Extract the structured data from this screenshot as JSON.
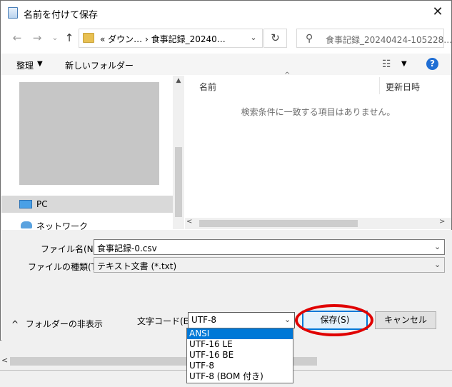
{
  "window": {
    "title": "名前を付けて保存",
    "close_glyph": "✕"
  },
  "nav": {
    "back": "←",
    "forward": "→",
    "recent": "⌄",
    "up": "↑"
  },
  "address": {
    "path": "« ダウン… › 食事記録_20240…",
    "dropdown": "⌄"
  },
  "refresh_glyph": "↻",
  "search": {
    "icon": "⚲",
    "placeholder": "食事記録_20240424-105228…"
  },
  "toolbar": {
    "organize": "整理",
    "organize_arrow": "▼",
    "new_folder": "新しいフォルダー",
    "view_glyph": "☷",
    "view_arrow": "▼",
    "help": "?"
  },
  "navpane": {
    "items": [
      "PC",
      "ネットワーク"
    ],
    "up_glyph": "▲"
  },
  "filepane": {
    "columns": [
      "名前",
      "更新日時"
    ],
    "sort_glyph": "^",
    "empty_message": "検索条件に一致する項目はありません。",
    "scroll_left": "<",
    "scroll_right": ">"
  },
  "form": {
    "filename_label": "ファイル名(N):",
    "filename_value": "食事記録-0.csv",
    "filetype_label": "ファイルの種類(T):",
    "filetype_value": "テキスト文書 (*.txt)",
    "hide_folders": "フォルダーの非表示",
    "hide_folders_glyph": "^",
    "encoding_label": "文字コード(E):",
    "encoding_value": "UTF-8",
    "encoding_options": [
      "ANSI",
      "UTF-16 LE",
      "UTF-16 BE",
      "UTF-8",
      "UTF-8 (BOM 付き)"
    ],
    "encoding_highlighted": "ANSI",
    "save": "保存(S)",
    "cancel": "キャンセル"
  },
  "background": {
    "scroll_left": "<"
  },
  "colors": {
    "accent": "#0078d7",
    "annotation": "#e00000"
  }
}
